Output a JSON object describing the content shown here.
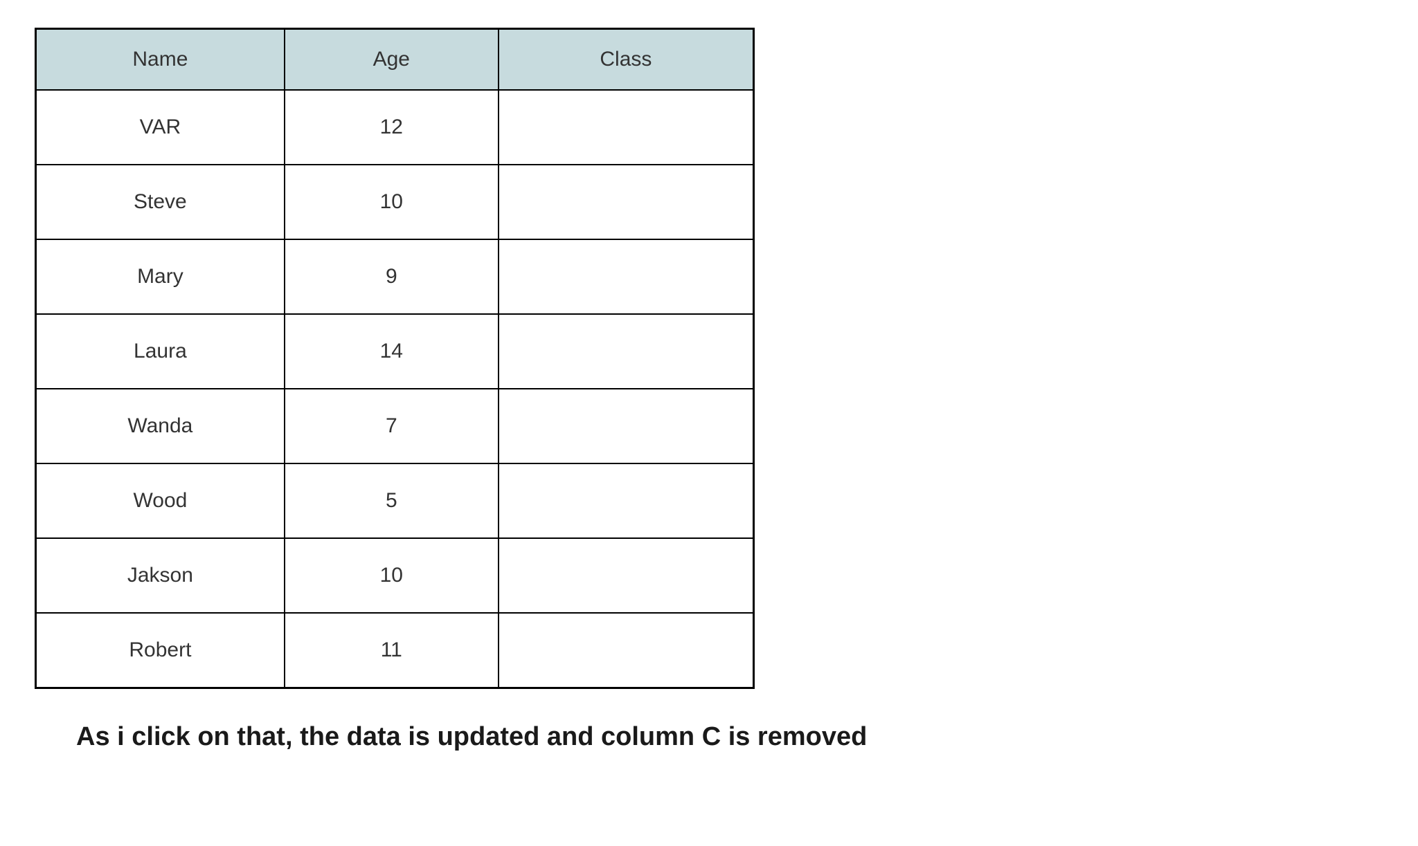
{
  "chart_data": {
    "type": "table",
    "headers": [
      "Name",
      "Age",
      "Class"
    ],
    "rows": [
      {
        "name": "VAR",
        "age": 12,
        "class": ""
      },
      {
        "name": "Steve",
        "age": 10,
        "class": ""
      },
      {
        "name": "Mary",
        "age": 9,
        "class": ""
      },
      {
        "name": "Laura",
        "age": 14,
        "class": ""
      },
      {
        "name": "Wanda",
        "age": 7,
        "class": ""
      },
      {
        "name": "Wood",
        "age": 5,
        "class": ""
      },
      {
        "name": "Jakson",
        "age": 10,
        "class": ""
      },
      {
        "name": "Robert",
        "age": 11,
        "class": ""
      }
    ]
  },
  "caption": "As i click on that, the data is updated and column C is removed"
}
